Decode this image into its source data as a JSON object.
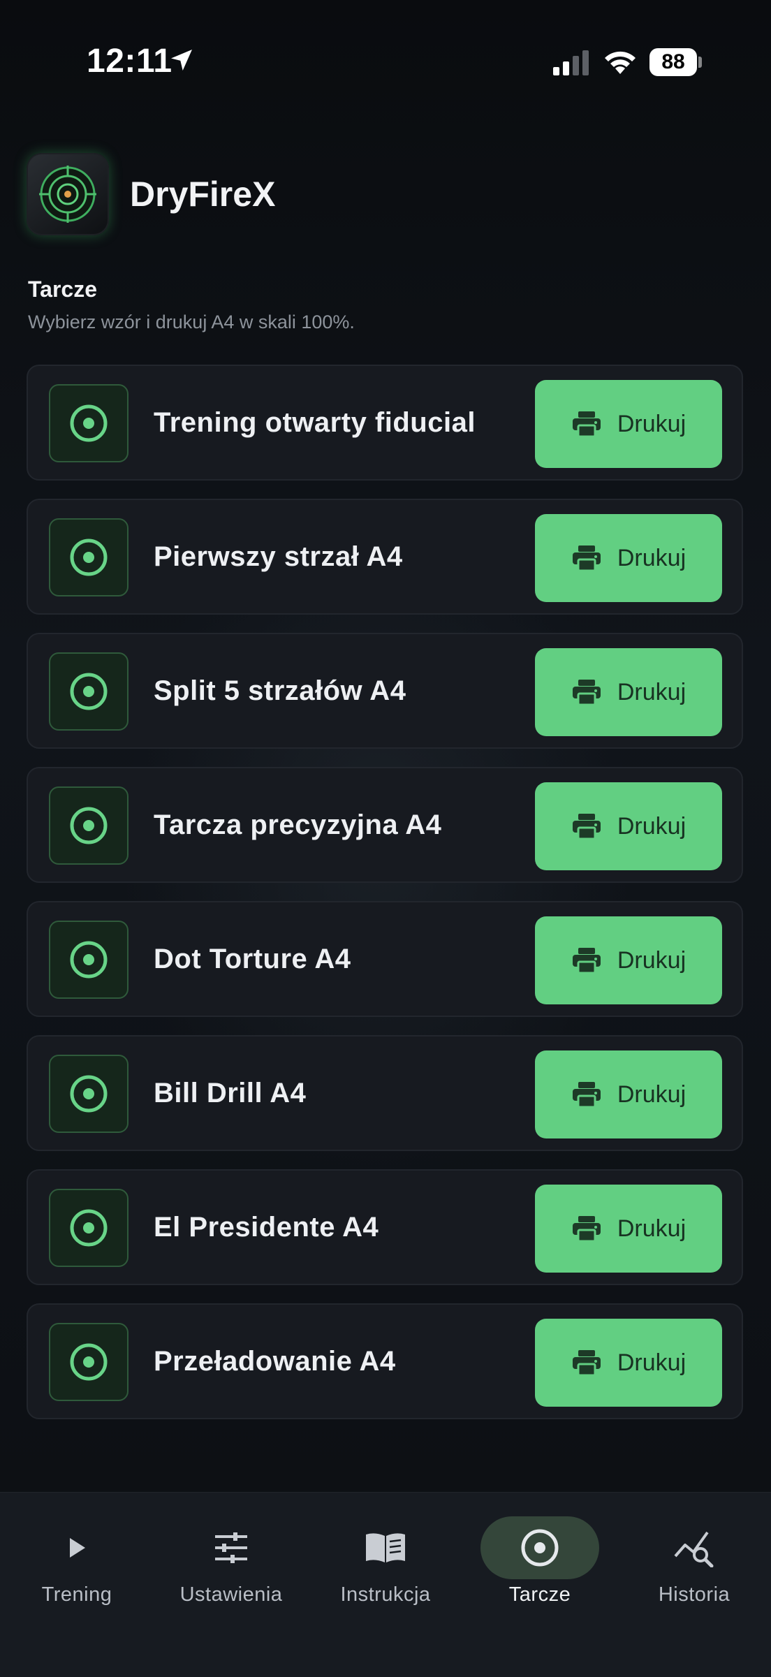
{
  "status_bar": {
    "time": "12:11",
    "battery": "88"
  },
  "app": {
    "title": "DryFireX"
  },
  "section": {
    "title": "Tarcze",
    "subtitle": "Wybierz wzór i drukuj A4 w skali 100%."
  },
  "targets": [
    {
      "name": "Trening otwarty fiducial",
      "button": "Drukuj"
    },
    {
      "name": "Pierwszy strzał A4",
      "button": "Drukuj"
    },
    {
      "name": "Split 5 strzałów A4",
      "button": "Drukuj"
    },
    {
      "name": "Tarcza precyzyjna A4",
      "button": "Drukuj"
    },
    {
      "name": "Dot Torture A4",
      "button": "Drukuj"
    },
    {
      "name": "Bill Drill A4",
      "button": "Drukuj"
    },
    {
      "name": "El Presidente A4",
      "button": "Drukuj"
    },
    {
      "name": "Przeładowanie A4",
      "button": "Drukuj"
    }
  ],
  "tabs": [
    {
      "label": "Trening",
      "icon": "play-icon"
    },
    {
      "label": "Ustawienia",
      "icon": "sliders-icon"
    },
    {
      "label": "Instrukcja",
      "icon": "book-icon"
    },
    {
      "label": "Tarcze",
      "icon": "target-icon",
      "active": true
    },
    {
      "label": "Historia",
      "icon": "chart-search-icon"
    }
  ],
  "colors": {
    "accent": "#62cf82",
    "background": "#0b0d10",
    "card": "#171a20"
  }
}
